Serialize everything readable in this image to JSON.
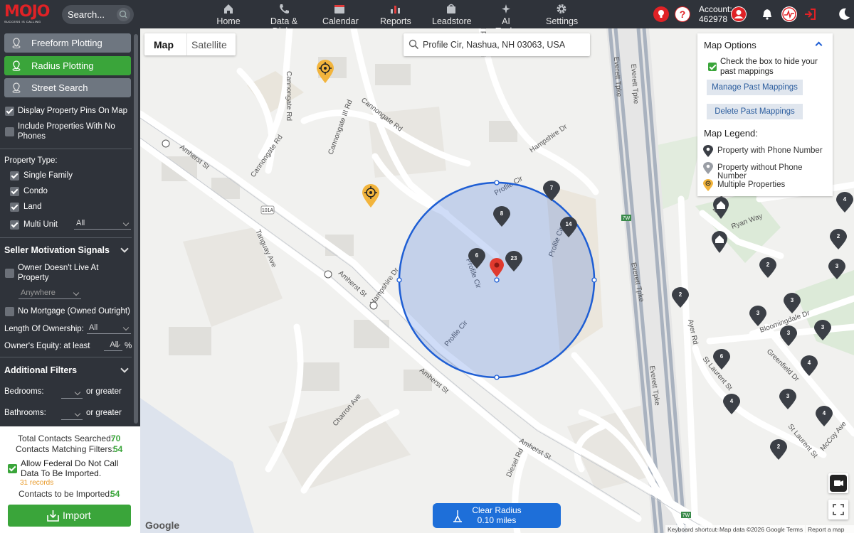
{
  "brand": {
    "logo_text": "MOJO",
    "logo_sub": "SUCCESS IS CALLING"
  },
  "search": {
    "placeholder": "Search..."
  },
  "nav": [
    {
      "label": "Home",
      "icon": "home-icon"
    },
    {
      "label": "Data & Dialer",
      "icon": "phone-icon"
    },
    {
      "label": "Calendar",
      "icon": "calendar-icon"
    },
    {
      "label": "Reports",
      "icon": "bar-chart-icon"
    },
    {
      "label": "Leadstore",
      "icon": "shopping-bag-icon"
    },
    {
      "label": "AI Tools",
      "icon": "sparkle-icon"
    },
    {
      "label": "Settings",
      "icon": "gear-icon"
    }
  ],
  "account": {
    "label": "Account:",
    "number": "462978"
  },
  "sidebar": {
    "modes": [
      "Freeform Plotting",
      "Radius Plotting",
      "Street Search"
    ],
    "active_mode": "Radius Plotting",
    "display_pins": "Display Property Pins On Map",
    "include_no_phone": "Include Properties With No Phones",
    "property_type_label": "Property Type:",
    "property_types": [
      "Single Family",
      "Condo",
      "Land",
      "Multi Unit"
    ],
    "multi_unit_value": "All",
    "seller_motivation": "Seller Motivation Signals",
    "owner_not_live": "Owner Doesn't Live At Property",
    "owner_anywhere": "Anywhere",
    "no_mortgage": "No Mortgage (Owned Outright)",
    "length_ownership_label": "Length Of Ownership:",
    "length_ownership_value": "All",
    "equity_label": "Owner's Equity: at least",
    "equity_value": "All",
    "equity_unit": "%",
    "additional_filters": "Additional Filters",
    "bedrooms_label": "Bedrooms:",
    "bathrooms_label": "Bathrooms:",
    "or_greater": "or greater"
  },
  "summary": {
    "total_label": "Total Contacts Searched:",
    "total_value": "70",
    "matching_label": "Contacts Matching Filters:",
    "matching_value": "54",
    "dnc_label": "Allow Federal Do Not Call Data To Be Imported.",
    "dnc_records": "31 records",
    "to_import_label": "Contacts to be Imported:",
    "to_import_value": "54",
    "import_button": "Import"
  },
  "map": {
    "tab_map": "Map",
    "tab_satellite": "Satellite",
    "address": "Profile Cir, Nashua, NH 03063, USA",
    "options_title": "Map Options",
    "hide_past": "Check the box to hide your past mappings",
    "manage_past": "Manage Past Mappings",
    "delete_past": "Delete Past Mappings",
    "legend_title": "Map Legend:",
    "legend": [
      "Property with Phone Number",
      "Property without Phone Number",
      "Multiple Properties"
    ],
    "clear_radius": "Clear Radius",
    "radius_value": "0.10 miles",
    "footer": [
      "Keyboard shortcuts",
      "Map data ©2026 Google",
      "Terms",
      "Report a map error"
    ],
    "google": "Google",
    "street_labels": [
      "Cannongate Rd",
      "Hartford Ln",
      "Cannongate Rd",
      "Cannongate III Rd",
      "Hampshire Dr",
      "Amherst St",
      "Cannongate Rd",
      "Everett Tpke",
      "Everett Tpke",
      "Profile Cir",
      "Profile Cir",
      "Profile Cir",
      "Profile Cir",
      "Hampshire Dr",
      "Amherst St",
      "Tanguay Ave",
      "Amherst St",
      "Charron Ave",
      "Diesel Rd",
      "Amherst St",
      "Everett Tpke",
      "Ayer Rd",
      "Ayer Rd",
      "Ryan Way",
      "Bloomingdale Dr",
      "Greenfield Dr",
      "St Laurent St",
      "St Laurent St",
      "McCoy Ave",
      "Everett Tpke"
    ],
    "shields": [
      "101A",
      "7W",
      "7W"
    ],
    "cluster_counts": [
      "7",
      "8",
      "14",
      "6",
      "23",
      "2",
      "3",
      "3",
      "3",
      "3",
      "6",
      "4",
      "4",
      "3",
      "4",
      "2",
      "2",
      "4",
      "3",
      "2"
    ]
  }
}
